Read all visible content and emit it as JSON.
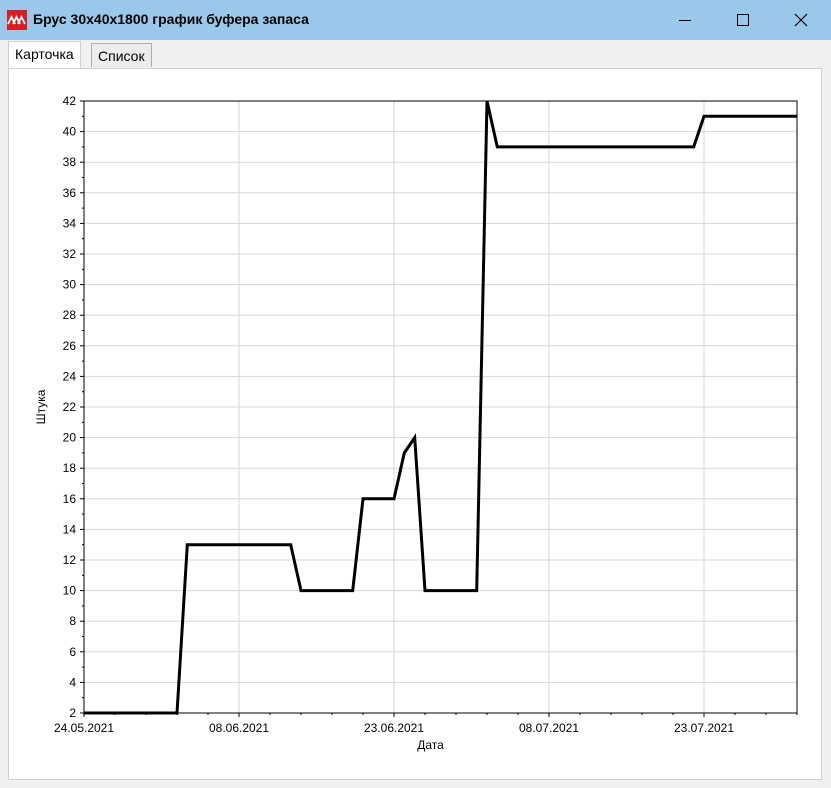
{
  "window": {
    "title": "Брус 30x40x1800 график буфера запаса",
    "app_icon": "app-logo-icon",
    "controls": [
      "minimize-icon",
      "maximize-icon",
      "close-icon"
    ]
  },
  "tabs": [
    {
      "label": "Карточка",
      "active": true
    },
    {
      "label": "Список",
      "active": false
    }
  ],
  "chart_data": {
    "type": "line",
    "xlabel": "Дата",
    "ylabel": "Штука",
    "ylim": [
      2,
      42
    ],
    "yticks": [
      2,
      4,
      6,
      8,
      10,
      12,
      14,
      16,
      18,
      20,
      22,
      24,
      26,
      28,
      30,
      32,
      34,
      36,
      38,
      40,
      42
    ],
    "xlim": [
      "2021-05-24",
      "2021-08-01"
    ],
    "xtick_labels": [
      {
        "date": "2021-05-24",
        "label": "24.05.2021"
      },
      {
        "date": "2021-06-08",
        "label": "08.06.2021"
      },
      {
        "date": "2021-06-23",
        "label": "23.06.2021"
      },
      {
        "date": "2021-07-08",
        "label": "08.07.2021"
      },
      {
        "date": "2021-07-23",
        "label": "23.07.2021"
      }
    ],
    "grid": true,
    "line_color": "#000000",
    "series": [
      {
        "x": [
          "2021-05-24",
          "2021-06-02",
          "2021-06-03",
          "2021-06-13",
          "2021-06-14",
          "2021-06-19",
          "2021-06-20",
          "2021-06-23",
          "2021-06-24",
          "2021-06-25",
          "2021-06-26",
          "2021-07-01",
          "2021-07-02",
          "2021-07-03",
          "2021-07-22",
          "2021-07-23",
          "2021-08-01"
        ],
        "y": [
          2,
          2,
          13,
          13,
          10,
          10,
          16,
          16,
          19,
          20,
          10,
          10,
          42,
          39,
          39,
          41,
          41
        ]
      }
    ]
  }
}
